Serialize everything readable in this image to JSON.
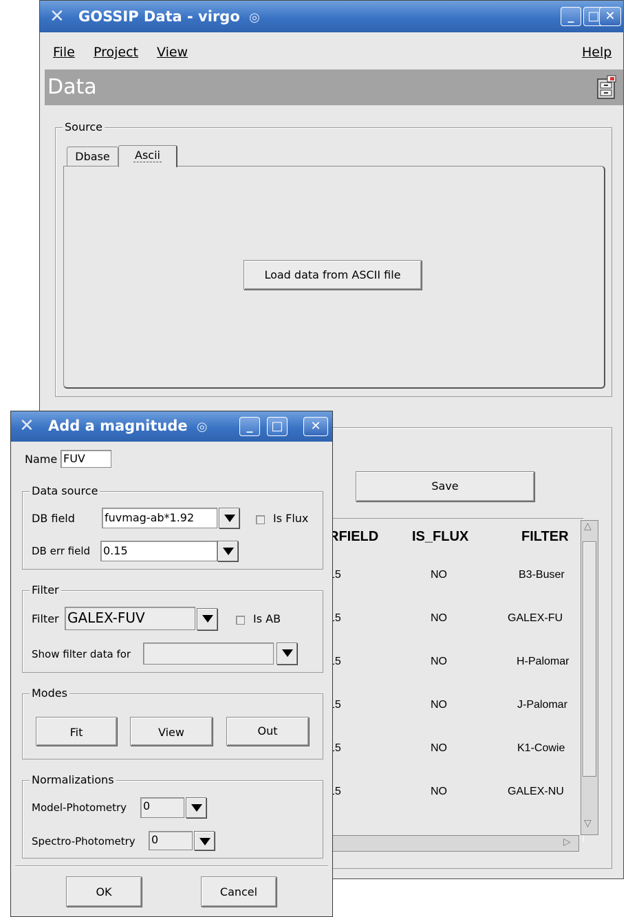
{
  "main_window": {
    "title": "GOSSIP Data - virgo",
    "controls": {
      "minimize": "_",
      "maximize": "□",
      "close": "✕"
    },
    "menu": {
      "file": "File",
      "project": "Project",
      "view": "View",
      "help": "Help"
    },
    "header_title": "Data",
    "source_group": {
      "legend": "Source",
      "tabs": [
        "Dbase",
        "Ascii"
      ],
      "active_tab": "Ascii",
      "load_button": "Load data from ASCII file"
    },
    "save_button": "Save",
    "table": {
      "columns": [
        "RFIELD",
        "IS_FLUX",
        "FILTER"
      ],
      "rows": [
        [
          "15",
          "NO",
          "B3-Buser"
        ],
        [
          "15",
          "NO",
          "GALEX-FU"
        ],
        [
          "15",
          "NO",
          "H-Palomar"
        ],
        [
          "15",
          "NO",
          "J-Palomar"
        ],
        [
          "15",
          "NO",
          "K1-Cowie"
        ],
        [
          "15",
          "NO",
          "GALEX-NU"
        ]
      ]
    }
  },
  "dialog": {
    "title": "Add a magnitude",
    "name_label": "Name",
    "name_value": "FUV",
    "data_source": {
      "legend": "Data source",
      "db_field_label": "DB field",
      "db_field_value": "fuvmag-ab*1.92",
      "is_flux_label": "Is Flux",
      "db_err_label": "DB err field",
      "db_err_value": "0.15"
    },
    "filter": {
      "legend": "Filter",
      "filter_label": "Filter",
      "filter_value": "GALEX-FUV",
      "is_ab_label": "Is AB",
      "show_label": "Show filter data for",
      "show_value": ""
    },
    "modes": {
      "legend": "Modes",
      "fit": "Fit",
      "view": "View",
      "out": "Out"
    },
    "normalizations": {
      "legend": "Normalizations",
      "model_label": "Model-Photometry",
      "model_value": "0",
      "spectro_label": "Spectro-Photometry",
      "spectro_value": "0"
    },
    "ok": "OK",
    "cancel": "Cancel"
  }
}
